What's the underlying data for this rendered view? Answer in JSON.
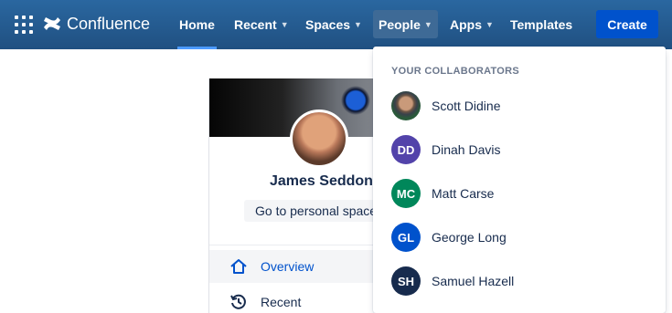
{
  "nav": {
    "brand": "Confluence",
    "items": [
      {
        "label": "Home"
      },
      {
        "label": "Recent"
      },
      {
        "label": "Spaces"
      },
      {
        "label": "People"
      },
      {
        "label": "Apps"
      },
      {
        "label": "Templates"
      }
    ],
    "create_label": "Create"
  },
  "profile": {
    "name": "James Seddon",
    "space_button": "Go to personal space",
    "nav": [
      {
        "label": "Overview"
      },
      {
        "label": "Recent"
      }
    ]
  },
  "dropdown": {
    "heading": "YOUR COLLABORATORS",
    "people": [
      {
        "initials": "",
        "name": "Scott Didine",
        "color": "#3a4a3f"
      },
      {
        "initials": "DD",
        "name": "Dinah Davis",
        "color": "#5243aa"
      },
      {
        "initials": "MC",
        "name": "Matt Carse",
        "color": "#00875a"
      },
      {
        "initials": "GL",
        "name": "George Long",
        "color": "#0052cc"
      },
      {
        "initials": "SH",
        "name": "Samuel Hazell",
        "color": "#172b4d"
      }
    ]
  },
  "colors": {
    "nav_bg": "#205081",
    "accent": "#0052cc",
    "text": "#172b4d"
  }
}
